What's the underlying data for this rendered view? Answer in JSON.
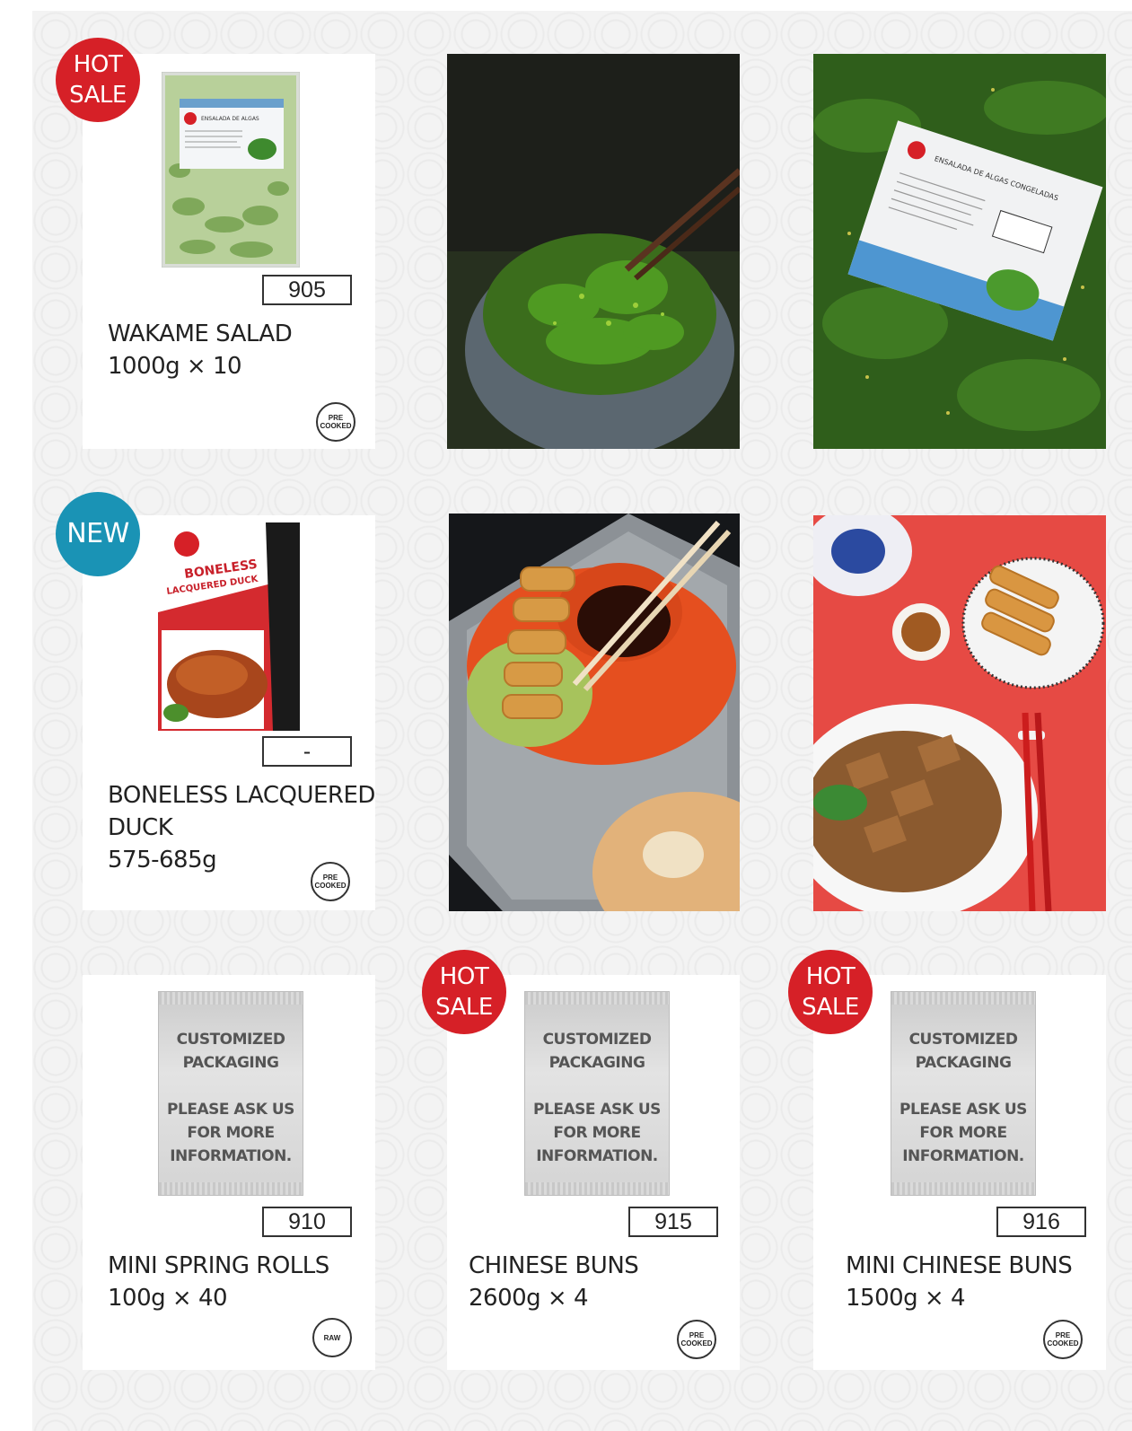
{
  "badges": {
    "hot_line1": "HOT",
    "hot_line2": "SALE",
    "new": "NEW"
  },
  "packaging_placeholder": {
    "line1": "CUSTOMIZED",
    "line2": "PACKAGING",
    "line3": "PLEASE ASK US",
    "line4": "FOR MORE",
    "line5": "INFORMATION."
  },
  "products": [
    {
      "code": "905",
      "name": "WAKAME SALAD",
      "weight": "1000g × 10",
      "stamp_line1": "PRE",
      "stamp_line2": "COOKED",
      "badge": "hot",
      "package_label": "ENSALADA DE ALGAS"
    },
    {
      "code": "-",
      "name_line1": "BONELESS LACQUERED",
      "name_line2": "DUCK",
      "weight": "575-685g",
      "stamp_line1": "PRE",
      "stamp_line2": "COOKED",
      "badge": "new",
      "package_label_line1": "BONELESS",
      "package_label_line2": "LACQUERED DUCK"
    },
    {
      "code": "910",
      "name": "MINI SPRING ROLLS",
      "weight": "100g × 40",
      "stamp_line1": "RAW",
      "badge": "none"
    },
    {
      "code": "915",
      "name": "CHINESE BUNS",
      "weight": "2600g × 4",
      "stamp_line1": "PRE",
      "stamp_line2": "COOKED",
      "badge": "hot"
    },
    {
      "code": "916",
      "name": "MINI CHINESE BUNS",
      "weight": "1500g × 4",
      "stamp_line1": "PRE",
      "stamp_line2": "COOKED",
      "badge": "hot"
    }
  ],
  "photos": [
    {
      "subject": "wakame-salad-bowl-photo"
    },
    {
      "subject": "wakame-package-photo",
      "label": "ENSALADA DE ALGAS CONGELADAS"
    },
    {
      "subject": "spring-rolls-plate-photo"
    },
    {
      "subject": "lacquered-duck-table-photo"
    }
  ],
  "colors": {
    "hot_badge": "#d62027",
    "new_badge": "#1a93b5",
    "background": "#f3f3f3"
  }
}
